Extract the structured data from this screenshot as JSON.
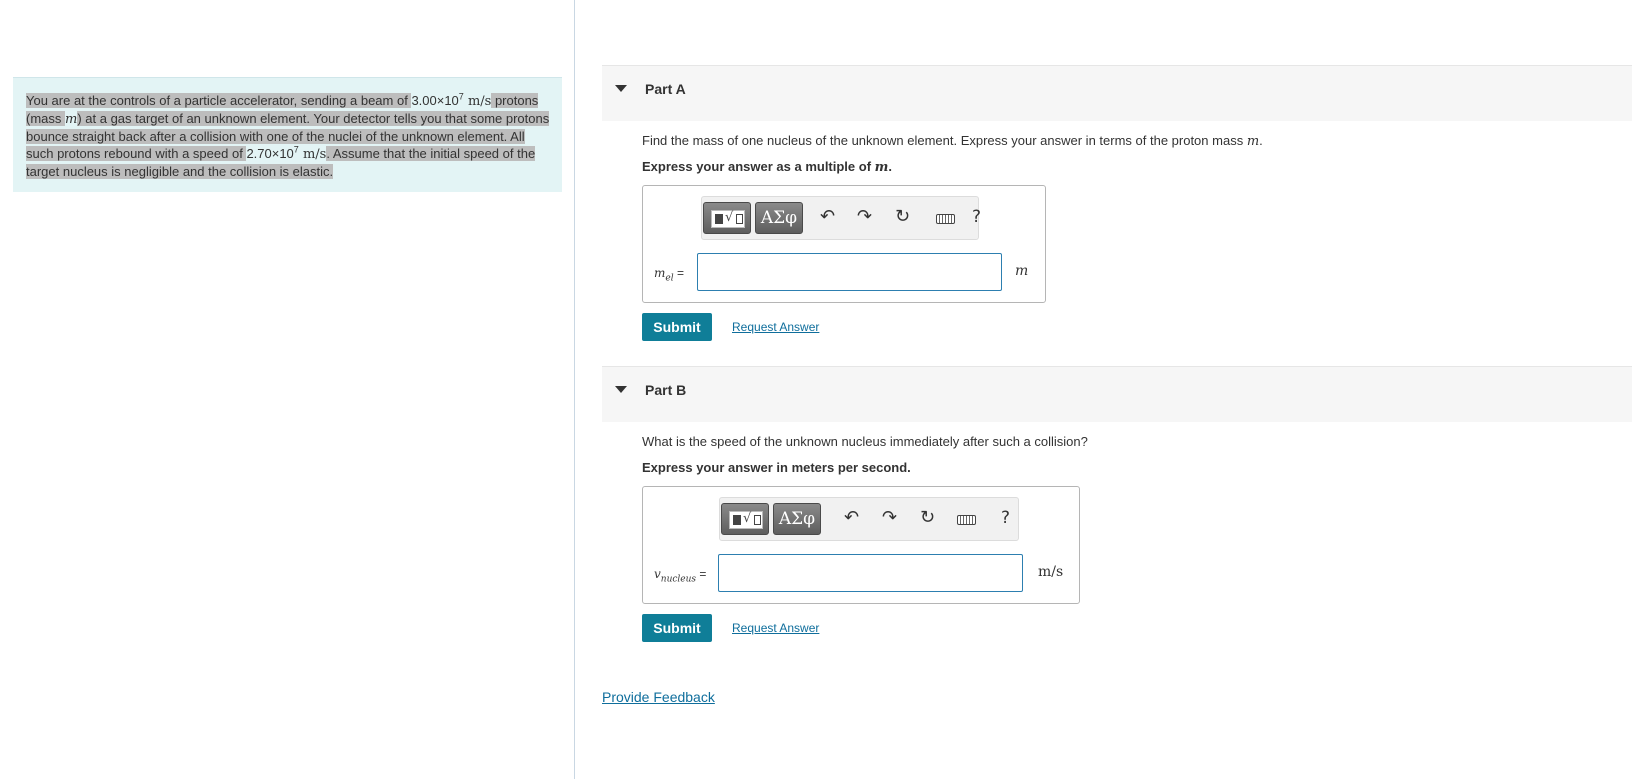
{
  "intro": {
    "t1": "You are at the controls of a particle accelerator, sending a beam of ",
    "v1_mant": "3.00×10",
    "v1_exp": "7",
    "unit1": " m/s",
    "t2": " protons (mass ",
    "mass_sym": "m",
    "t3": ") at a gas target of an unknown element. Your detector tells you that some protons bounce straight back after a collision with one of the nuclei of the unknown element. All such protons rebound with a speed of ",
    "v2_mant": "2.70×10",
    "v2_exp": "7",
    "unit2": " m/s",
    "t4": ". Assume that the initial speed of the target nucleus is negligible and the collision is elastic."
  },
  "partA": {
    "title": "Part A",
    "question_text": "Find the mass of one nucleus of the unknown element. Express your answer in terms of the proton mass ",
    "question_sym": "m",
    "question_end": ".",
    "instruction_text": "Express your answer as a multiple of ",
    "instruction_sym": "m",
    "instruction_end": ".",
    "var_main": "m",
    "var_sub": "el",
    "equals": " =",
    "answer_value": "",
    "unit": "m",
    "submit_label": "Submit",
    "request_label": "Request Answer"
  },
  "partB": {
    "title": "Part B",
    "question_text": "What is the speed of the unknown nucleus immediately after such a collision?",
    "instruction_text": "Express your answer in meters per second.",
    "var_main": "v",
    "var_sub": "nucleus",
    "equals": " =",
    "answer_value": "",
    "unit": "m/s",
    "submit_label": "Submit",
    "request_label": "Request Answer"
  },
  "toolbar": {
    "greek_label": "ΑΣφ",
    "help_label": "?",
    "undo_icon": "↶",
    "redo_icon": "↷",
    "reset_icon": "↻"
  },
  "feedback_label": "Provide Feedback"
}
